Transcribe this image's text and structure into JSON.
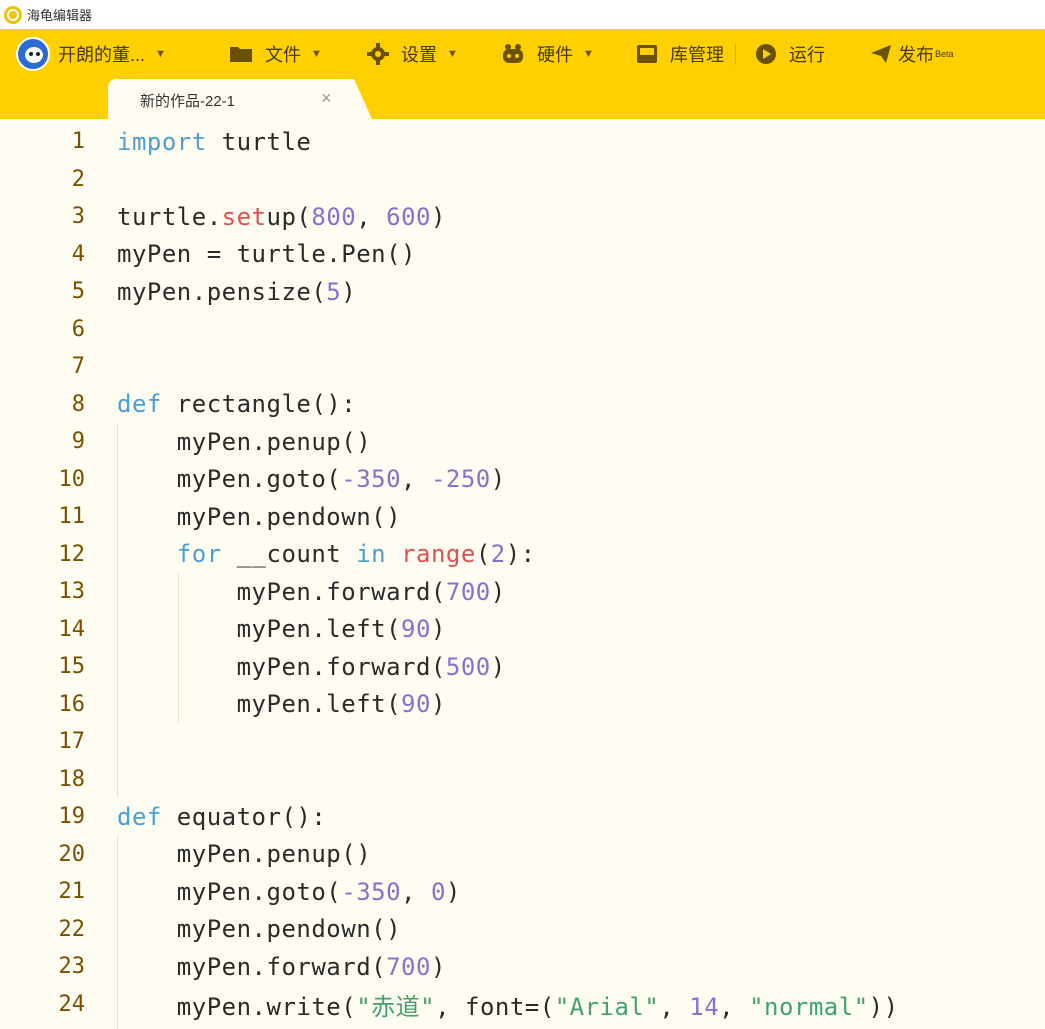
{
  "app": {
    "title": "海龟编辑器"
  },
  "toolbar": {
    "user": "开朗的董...",
    "file": "文件",
    "settings": "设置",
    "hardware": "硬件",
    "library": "库管理",
    "run": "运行",
    "publish": "发布",
    "publish_badge": "Beta"
  },
  "tab": {
    "title": "新的作品-22-1",
    "close": "×"
  },
  "colors": {
    "toolbar": "#ffd000",
    "editor_bg": "#fffdf2",
    "keyword": "#4a9fd4",
    "builtin": "#e05050",
    "number": "#8a6fd1",
    "string": "#3fa56a"
  },
  "code": {
    "lines": [
      [
        [
          "kw",
          "import"
        ],
        [
          "t",
          " turtle"
        ]
      ],
      [],
      [
        [
          "t",
          "turtle."
        ],
        [
          "fn",
          "set"
        ],
        [
          "t",
          "up("
        ],
        [
          "num",
          "800"
        ],
        [
          "t",
          ", "
        ],
        [
          "num",
          "600"
        ],
        [
          "t",
          ")"
        ]
      ],
      [
        [
          "t",
          "myPen = turtle.Pen()"
        ]
      ],
      [
        [
          "t",
          "myPen.pensize("
        ],
        [
          "num",
          "5"
        ],
        [
          "t",
          ")"
        ]
      ],
      [],
      [],
      [
        [
          "kw",
          "def"
        ],
        [
          "t",
          " rectangle():"
        ]
      ],
      [
        [
          "t",
          "    myPen.penup()"
        ]
      ],
      [
        [
          "t",
          "    myPen.goto("
        ],
        [
          "num",
          "-350"
        ],
        [
          "t",
          ", "
        ],
        [
          "num",
          "-250"
        ],
        [
          "t",
          ")"
        ]
      ],
      [
        [
          "t",
          "    myPen.pendown()"
        ]
      ],
      [
        [
          "t",
          "    "
        ],
        [
          "kw",
          "for"
        ],
        [
          "t",
          " __count "
        ],
        [
          "kw",
          "in"
        ],
        [
          "t",
          " "
        ],
        [
          "fn",
          "range"
        ],
        [
          "t",
          "("
        ],
        [
          "num",
          "2"
        ],
        [
          "t",
          "):"
        ]
      ],
      [
        [
          "t",
          "        myPen.forward("
        ],
        [
          "num",
          "700"
        ],
        [
          "t",
          ")"
        ]
      ],
      [
        [
          "t",
          "        myPen.left("
        ],
        [
          "num",
          "90"
        ],
        [
          "t",
          ")"
        ]
      ],
      [
        [
          "t",
          "        myPen.forward("
        ],
        [
          "num",
          "500"
        ],
        [
          "t",
          ")"
        ]
      ],
      [
        [
          "t",
          "        myPen.left("
        ],
        [
          "num",
          "90"
        ],
        [
          "t",
          ")"
        ]
      ],
      [],
      [],
      [
        [
          "kw",
          "def"
        ],
        [
          "t",
          " equator():"
        ]
      ],
      [
        [
          "t",
          "    myPen.penup()"
        ]
      ],
      [
        [
          "t",
          "    myPen.goto("
        ],
        [
          "num",
          "-350"
        ],
        [
          "t",
          ", "
        ],
        [
          "num",
          "0"
        ],
        [
          "t",
          ")"
        ]
      ],
      [
        [
          "t",
          "    myPen.pendown()"
        ]
      ],
      [
        [
          "t",
          "    myPen.forward("
        ],
        [
          "num",
          "700"
        ],
        [
          "t",
          ")"
        ]
      ],
      [
        [
          "t",
          "    myPen.write("
        ],
        [
          "str",
          "\"赤道\""
        ],
        [
          "t",
          ", font=("
        ],
        [
          "str",
          "\"Arial\""
        ],
        [
          "t",
          ", "
        ],
        [
          "num",
          "14"
        ],
        [
          "t",
          ", "
        ],
        [
          "str",
          "\"normal\""
        ],
        [
          "t",
          "))"
        ]
      ]
    ]
  }
}
